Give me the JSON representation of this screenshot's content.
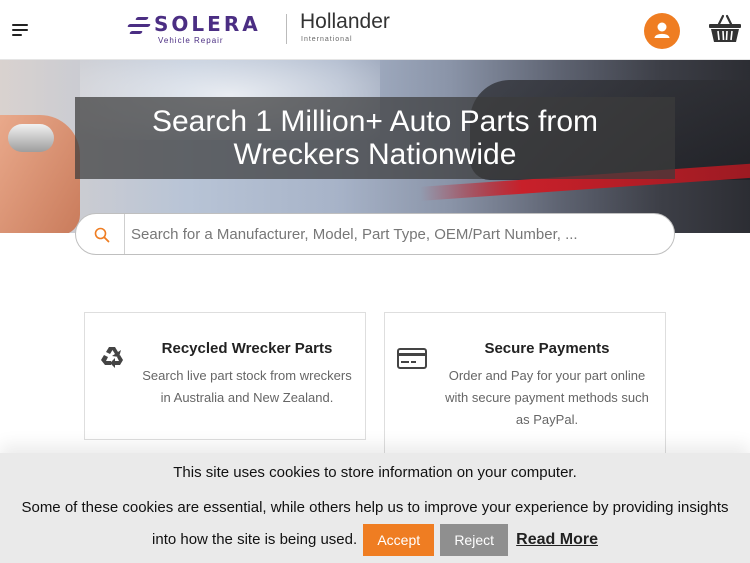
{
  "header": {
    "menu_icon": "hamburger-menu-icon",
    "logo": {
      "brand": "SOLERA",
      "brand_sub": "Vehicle Repair",
      "partner": "Hollander",
      "partner_sub": "International"
    },
    "user_icon": "user-icon",
    "cart_icon": "basket-icon",
    "accent_color": "#ef7d22",
    "brand_color": "#4b2e83"
  },
  "hero": {
    "title_line1": "Search 1 Million+ Auto Parts from",
    "title_line2": "Wreckers Nationwide"
  },
  "search": {
    "icon": "search-icon",
    "placeholder": "Search for a Manufacturer, Model, Part Type, OEM/Part Number, ..."
  },
  "features": [
    {
      "icon": "recycle-icon",
      "title": "Recycled Wrecker Parts",
      "text": "Search live part stock from wreckers in Australia and New Zealand."
    },
    {
      "icon": "credit-card-icon",
      "title": "Secure Payments",
      "text": "Order and Pay for your part online with secure payment methods such as PayPal."
    }
  ],
  "cookie": {
    "line1": "This site uses cookies to store information on your computer.",
    "line2": "Some of these cookies are essential, while others help us to improve your experience by providing insights into how the site is being used.",
    "accept_label": "Accept",
    "reject_label": "Reject",
    "read_more_label": "Read More"
  }
}
